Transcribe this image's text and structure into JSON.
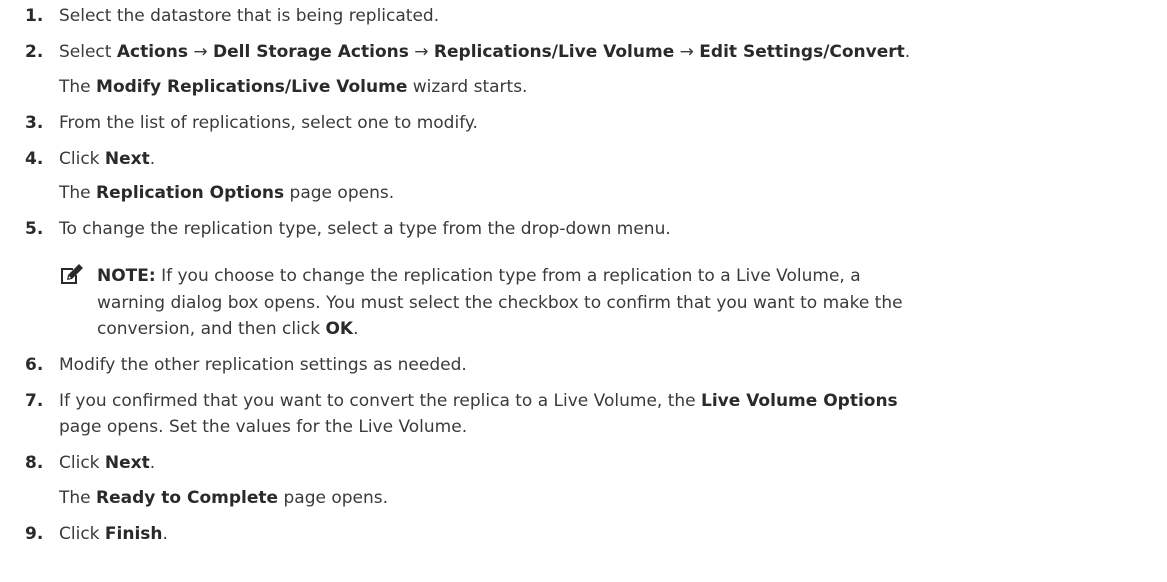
{
  "steps": [
    {
      "num": "1.",
      "a": "Select the datastore that is being replicated."
    },
    {
      "num": "2.",
      "a": "Select ",
      "b1": "Actions",
      "c": " → ",
      "b2": "Dell Storage Actions",
      "d": " → ",
      "b3": "Replications/Live Volume",
      "e": " → ",
      "b4": "Edit Settings/Convert",
      "f": "."
    },
    {
      "a": "The ",
      "b": "Modify Replications/Live Volume",
      "c": " wizard starts."
    },
    {
      "num": "3.",
      "a": "From the list of replications, select one to modify."
    },
    {
      "num": "4.",
      "a": "Click ",
      "b": "Next",
      "c": "."
    },
    {
      "a": "The ",
      "b": "Replication Options",
      "c": " page opens."
    },
    {
      "num": "5.",
      "a": "To change the replication type, select a type from the drop-down menu."
    },
    {
      "num": "6.",
      "a": "Modify the other replication settings as needed."
    },
    {
      "num": "7.",
      "a": "If you confirmed that you want to convert the replica to a Live Volume, the ",
      "b": "Live Volume Options"
    },
    {
      "a": "page opens. Set the values for the Live Volume."
    },
    {
      "num": "8.",
      "a": "Click ",
      "b": "Next",
      "c": "."
    },
    {
      "a": "The ",
      "b": "Ready to Complete",
      "c": " page opens."
    },
    {
      "num": "9.",
      "a": "Click ",
      "b": "Finish",
      "c": "."
    }
  ],
  "note": {
    "icon": "pencil-note-icon",
    "label": "NOTE:",
    "line1": " If you choose to change the replication type from a replication to a Live Volume, a",
    "line2": "warning dialog box opens. You must select the checkbox to confirm that you want to make the",
    "line3a": "conversion, and then click ",
    "line3b": "OK",
    "line3c": "."
  }
}
